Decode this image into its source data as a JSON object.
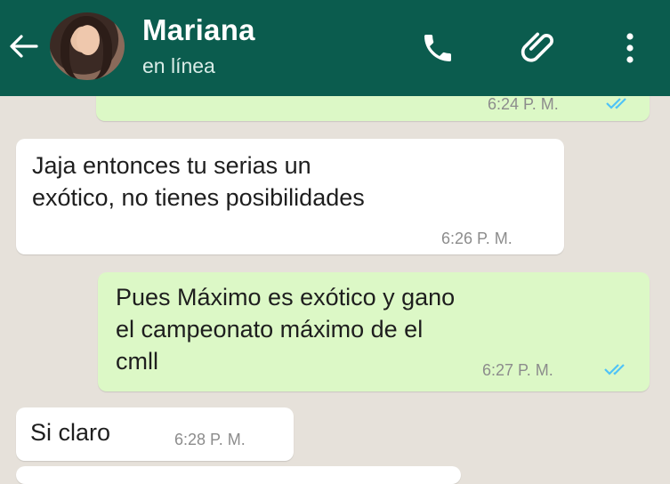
{
  "header": {
    "contact_name": "Mariana",
    "status": "en línea",
    "icons": [
      "back-arrow-icon",
      "phone-icon",
      "paperclip-icon",
      "more-vert-icon"
    ],
    "background_color": "#0b5c4e"
  },
  "messages": [
    {
      "direction": "outgoing",
      "text": "",
      "time": "6:24 P. M.",
      "read": true
    },
    {
      "direction": "incoming",
      "text": "Jaja entonces tu serias un\nexótico, no tienes posibilidades",
      "time": "6:26 P. M."
    },
    {
      "direction": "outgoing",
      "text": "Pues Máximo es exótico y gano\nel campeonato máximo de el\ncmll",
      "time": "6:27 P. M.",
      "read": true
    },
    {
      "direction": "incoming",
      "text": "Si claro",
      "time": "6:28 P. M."
    }
  ],
  "colors": {
    "outgoing_bubble": "#dcf8c6",
    "incoming_bubble": "#ffffff",
    "read_ticks": "#4fc3f7",
    "chat_background": "#e6e1da"
  }
}
